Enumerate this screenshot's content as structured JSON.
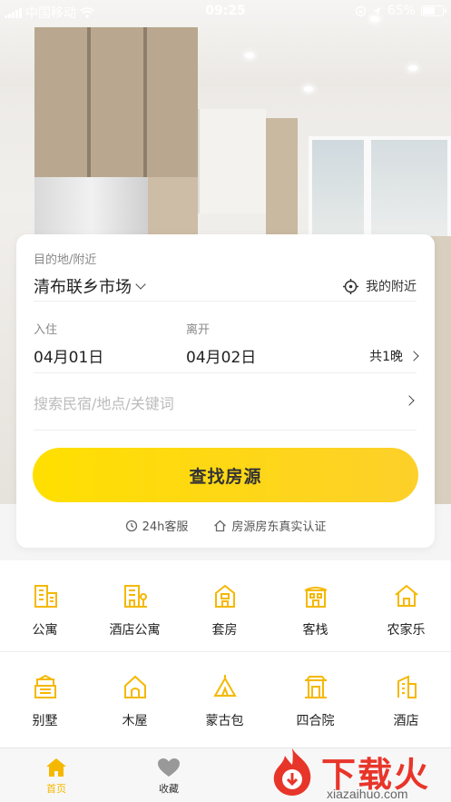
{
  "status_bar": {
    "carrier": "中国移动",
    "time": "09:25",
    "battery": "65%",
    "battery_level": 0.65
  },
  "search_card": {
    "destination_label": "目的地/附近",
    "destination_city": "清布联乡市场",
    "nearby_label": "我的附近",
    "checkin_label": "入住",
    "checkout_label": "离开",
    "checkin_date": "04月01日",
    "checkout_date": "04月02日",
    "nights": "共1晚",
    "search_placeholder": "搜索民宿/地点/关键词",
    "find_button": "查找房源",
    "assurance_1": "24h客服",
    "assurance_2": "房源房东真实认证"
  },
  "categories": [
    {
      "label": "公寓",
      "icon": "apartment-icon"
    },
    {
      "label": "酒店公寓",
      "icon": "hotel-apartment-icon"
    },
    {
      "label": "套房",
      "icon": "suite-icon"
    },
    {
      "label": "客栈",
      "icon": "inn-icon"
    },
    {
      "label": "农家乐",
      "icon": "farmhouse-icon"
    },
    {
      "label": "别墅",
      "icon": "villa-icon"
    },
    {
      "label": "木屋",
      "icon": "cabin-icon"
    },
    {
      "label": "蒙古包",
      "icon": "yurt-icon"
    },
    {
      "label": "四合院",
      "icon": "courtyard-icon"
    },
    {
      "label": "酒店",
      "icon": "hotel-icon"
    }
  ],
  "tabbar": {
    "home": "首页",
    "favorites": "收藏"
  },
  "watermark": {
    "text": "下载火",
    "url": "xiazaihuo.com"
  },
  "colors": {
    "accent": "#F5B800",
    "button": "#FFDA1A",
    "watermark": "#E8352A"
  }
}
